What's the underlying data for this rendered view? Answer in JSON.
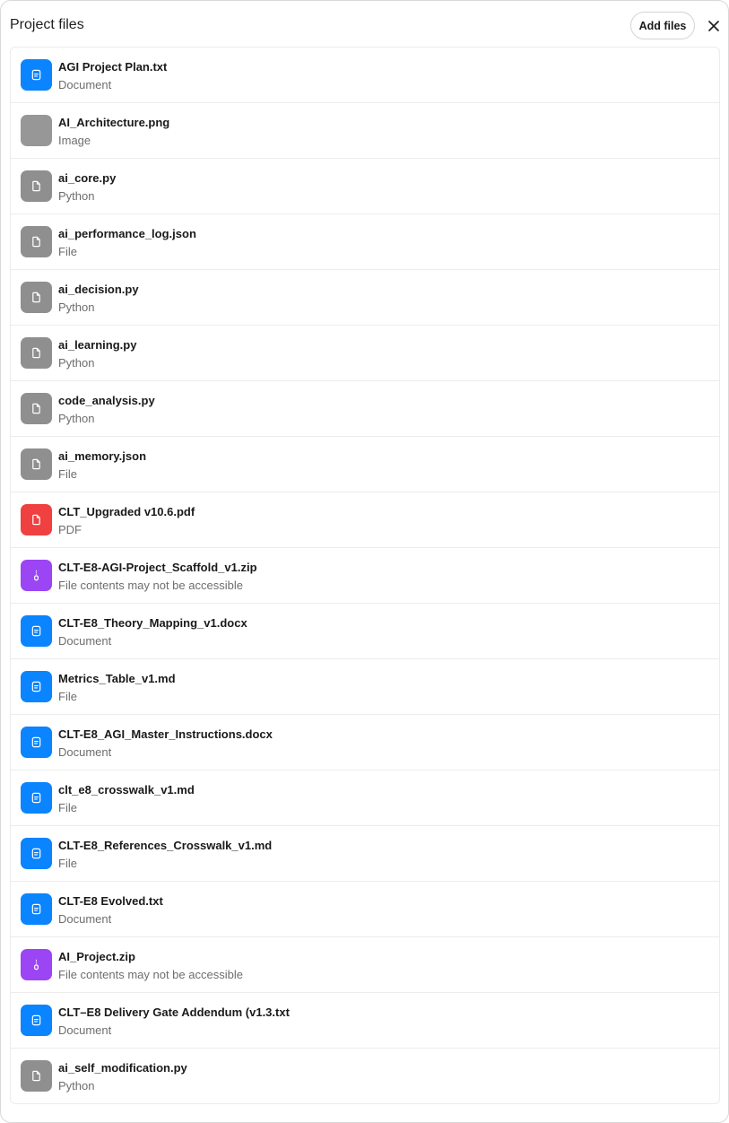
{
  "header": {
    "title": "Project files",
    "add_files_label": "Add files",
    "close_icon": "close-icon"
  },
  "colors": {
    "document": "#0a84ff",
    "image": "#979797",
    "generic": "#8f8f8f",
    "pdf": "#f04040",
    "archive": "#9b45f5"
  },
  "files": [
    {
      "name": "AGI Project Plan.txt",
      "type": "Document",
      "kind": "document"
    },
    {
      "name": "AI_Architecture.png",
      "type": "Image",
      "kind": "image"
    },
    {
      "name": "ai_core.py",
      "type": "Python",
      "kind": "generic"
    },
    {
      "name": "ai_performance_log.json",
      "type": "File",
      "kind": "generic"
    },
    {
      "name": "ai_decision.py",
      "type": "Python",
      "kind": "generic"
    },
    {
      "name": "ai_learning.py",
      "type": "Python",
      "kind": "generic"
    },
    {
      "name": "code_analysis.py",
      "type": "Python",
      "kind": "generic"
    },
    {
      "name": "ai_memory.json",
      "type": "File",
      "kind": "generic"
    },
    {
      "name": "CLT_Upgraded v10.6.pdf",
      "type": "PDF",
      "kind": "pdf"
    },
    {
      "name": "CLT-E8-AGI-Project_Scaffold_v1.zip",
      "type": "File contents may not be accessible",
      "kind": "archive"
    },
    {
      "name": "CLT-E8_Theory_Mapping_v1.docx",
      "type": "Document",
      "kind": "document"
    },
    {
      "name": "Metrics_Table_v1.md",
      "type": "File",
      "kind": "document"
    },
    {
      "name": "CLT-E8_AGI_Master_Instructions.docx",
      "type": "Document",
      "kind": "document"
    },
    {
      "name": "clt_e8_crosswalk_v1.md",
      "type": "File",
      "kind": "document"
    },
    {
      "name": "CLT-E8_References_Crosswalk_v1.md",
      "type": "File",
      "kind": "document"
    },
    {
      "name": "CLT-E8 Evolved.txt",
      "type": "Document",
      "kind": "document"
    },
    {
      "name": "AI_Project.zip",
      "type": "File contents may not be accessible",
      "kind": "archive"
    },
    {
      "name": "CLT–E8 Delivery Gate Addendum (v1.3.txt",
      "type": "Document",
      "kind": "document"
    },
    {
      "name": "ai_self_modification.py",
      "type": "Python",
      "kind": "generic"
    }
  ]
}
